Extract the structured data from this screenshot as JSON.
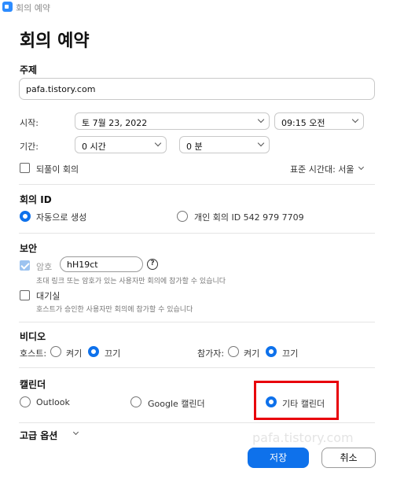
{
  "window": {
    "title": "회의 예약"
  },
  "heading": "회의 예약",
  "topic": {
    "label": "주제",
    "value": "pafa.tistory.com"
  },
  "start": {
    "label": "시작:",
    "date": "토  7월  23,  2022",
    "time": "09:15  오전"
  },
  "duration": {
    "label": "기간:",
    "hours": "0 시간",
    "minutes": "0 분"
  },
  "recurring": {
    "label": "되풀이 회의",
    "checked": false
  },
  "timezone": {
    "value": "표준 시간대: 서울"
  },
  "meeting_id": {
    "section": "회의 ID",
    "auto_label": "자동으로 생성",
    "personal_label": "개인 회의 ID 542 979 7709",
    "selected": "auto"
  },
  "security": {
    "section": "보안",
    "passcode_label": "암호",
    "passcode_value": "hH19ct",
    "passcode_checked": true,
    "passcode_hint": "초대 링크 또는 암호가 있는 사용자만 회의에 참가할 수 있습니다",
    "waiting_room_label": "대기실",
    "waiting_room_checked": false,
    "waiting_room_hint": "호스트가 승인한 사용자만 회의에 참가할 수 있습니다"
  },
  "video": {
    "section": "비디오",
    "host_label": "호스트:",
    "participants_label": "참가자:",
    "on_label": "켜기",
    "off_label": "끄기",
    "host_selected": "off",
    "participants_selected": "off"
  },
  "calendar": {
    "section": "캘린더",
    "outlook": "Outlook",
    "google": "Google 캘린더",
    "other": "기타 캘린더",
    "selected": "other"
  },
  "advanced": {
    "label": "고급 옵션"
  },
  "watermark": "pafa.tistory.com",
  "buttons": {
    "save": "저장",
    "cancel": "취소"
  },
  "colors": {
    "accent": "#0e71eb",
    "highlight": "#e8000b"
  }
}
